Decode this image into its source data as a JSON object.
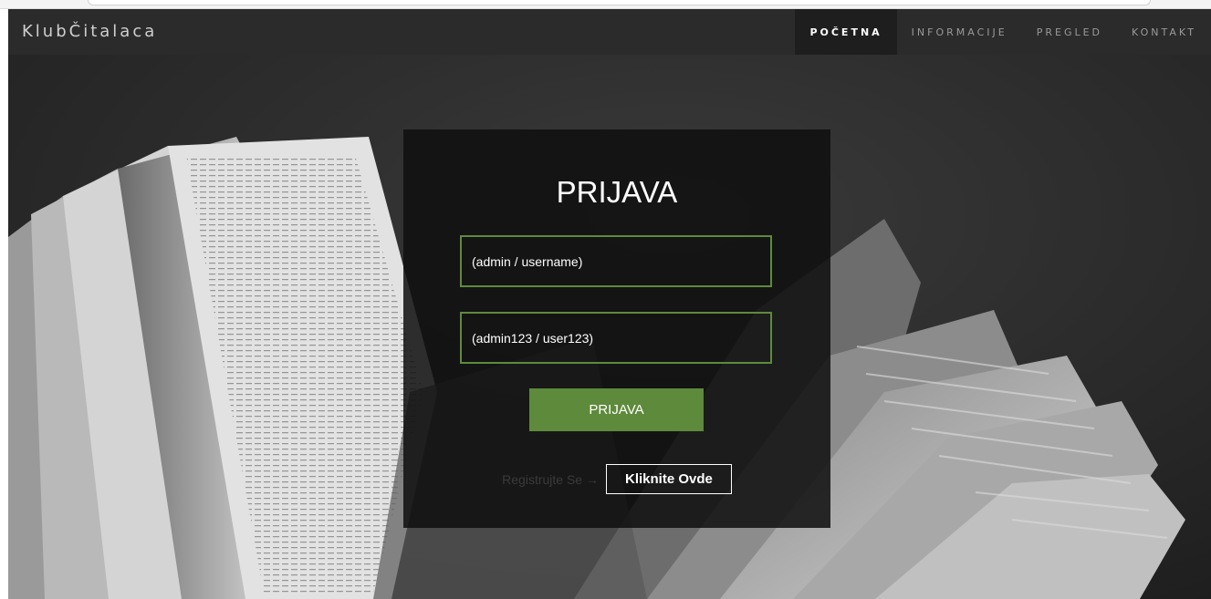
{
  "navbar": {
    "brand": "KlubČitalaca",
    "items": [
      {
        "label": "POČETNA",
        "active": true
      },
      {
        "label": "INFORMACIJE",
        "active": false
      },
      {
        "label": "PREGLED",
        "active": false
      },
      {
        "label": "KONTAKT",
        "active": false
      }
    ]
  },
  "login": {
    "title": "PRIJAVA",
    "username_placeholder": "(admin / username)",
    "password_placeholder": "(admin123 / user123)",
    "submit_label": "PRIJAVA",
    "register_text": "Registrujte Se →",
    "register_button_label": "Kliknite Ovde"
  },
  "colors": {
    "accent_green": "#5e8a3b",
    "navbar_bg": "#2b2b2b",
    "panel_bg": "#0f0f0f"
  }
}
